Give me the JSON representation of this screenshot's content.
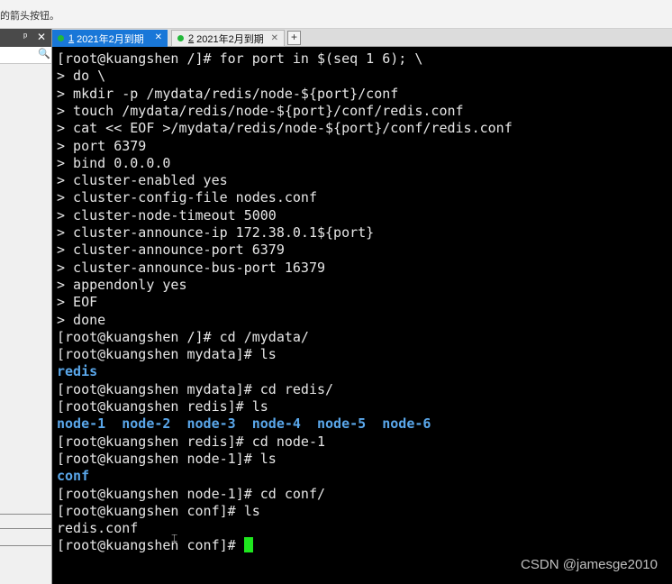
{
  "top_hint": "的箭头按钮。",
  "left_panel": {
    "pin_glyph": "ᵖ",
    "close_glyph": "✕",
    "search_glyph": "🔍"
  },
  "tabs": [
    {
      "num": "1",
      "label": "2021年2月到期",
      "active": true,
      "close": "✕"
    },
    {
      "num": "2",
      "label": "2021年2月到期",
      "active": false,
      "close": "✕"
    }
  ],
  "new_tab_label": "+",
  "terminal": {
    "lines": [
      {
        "text": "[root@kuangshen /]# for port in $(seq 1 6); \\"
      },
      {
        "text": "> do \\"
      },
      {
        "text": "> mkdir -p /mydata/redis/node-${port}/conf"
      },
      {
        "text": "> touch /mydata/redis/node-${port}/conf/redis.conf"
      },
      {
        "text": "> cat << EOF >/mydata/redis/node-${port}/conf/redis.conf"
      },
      {
        "text": "> port 6379"
      },
      {
        "text": "> bind 0.0.0.0"
      },
      {
        "text": "> cluster-enabled yes"
      },
      {
        "text": "> cluster-config-file nodes.conf"
      },
      {
        "text": "> cluster-node-timeout 5000"
      },
      {
        "text": "> cluster-announce-ip 172.38.0.1${port}"
      },
      {
        "text": "> cluster-announce-port 6379"
      },
      {
        "text": "> cluster-announce-bus-port 16379"
      },
      {
        "text": "> appendonly yes"
      },
      {
        "text": "> EOF"
      },
      {
        "text": "> done"
      },
      {
        "text": "[root@kuangshen /]# cd /mydata/"
      },
      {
        "text": "[root@kuangshen mydata]# ls"
      },
      {
        "text": "redis",
        "kind": "dir"
      },
      {
        "text": "[root@kuangshen mydata]# cd redis/"
      },
      {
        "text": "[root@kuangshen redis]# ls"
      },
      {
        "text": "node-1  node-2  node-3  node-4  node-5  node-6",
        "kind": "dir"
      },
      {
        "text": "[root@kuangshen redis]# cd node-1"
      },
      {
        "text": "[root@kuangshen node-1]# ls"
      },
      {
        "text": "conf",
        "kind": "dir"
      },
      {
        "text": "[root@kuangshen node-1]# cd conf/"
      },
      {
        "text": "[root@kuangshen conf]# ls"
      },
      {
        "text": "redis.conf"
      },
      {
        "text": "[root@kuangshen conf]# ",
        "cursor": true
      }
    ],
    "text_color": "#e6e6e6",
    "dir_color": "#5aa7ea",
    "cursor_color": "#1ee61e"
  },
  "watermark": "CSDN @jamesge2010",
  "colors": {
    "active_tab": "#1977d8",
    "tab_dot": "#22b83a",
    "terminal_bg": "#000000"
  }
}
